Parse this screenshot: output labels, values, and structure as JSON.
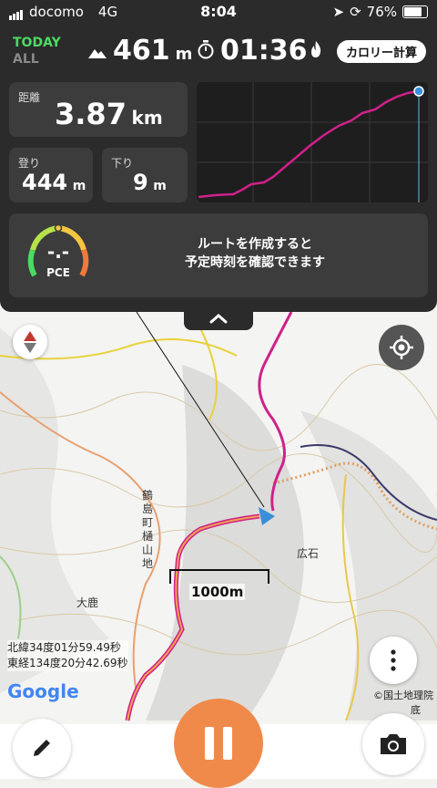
{
  "status": {
    "carrier": "docomo",
    "network": "4G",
    "time": "8:04",
    "battery": "76%"
  },
  "header": {
    "today": "TODAY",
    "all": "ALL",
    "elevation": "461",
    "elevation_unit": "m",
    "elapsed": "01:36",
    "calorie_button": "カロリー計算"
  },
  "stats": {
    "distance_label": "距離",
    "distance": "3.87",
    "distance_unit": "km",
    "up_label": "登り",
    "up": "444",
    "up_unit": "m",
    "down_label": "下り",
    "down": "9",
    "down_unit": "m"
  },
  "pce": {
    "value": "-.-",
    "label": "PCE",
    "message_line1": "ルートを作成すると",
    "message_line2": "予定時刻を確認できます"
  },
  "map": {
    "labels": [
      "鶴島町樋山地",
      "広石",
      "大鹿"
    ],
    "lat": "北緯34度01分59.49秒",
    "lon": "東経134度20分42.69秒",
    "scale": "1000m",
    "google": "Google",
    "copyright": "©国土地理院",
    "bottom_glyph": "底"
  },
  "colors": {
    "track": "#d0208a",
    "accent_green": "#4cd964",
    "pause_button": "#f08a4b",
    "location_arrow": "#3a8fd8"
  }
}
